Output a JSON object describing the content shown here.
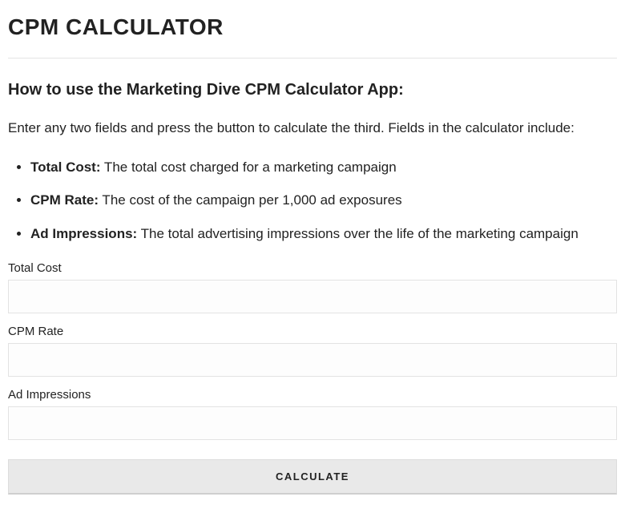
{
  "page_title": "CPM CALCULATOR",
  "section_heading": "How to use the Marketing Dive CPM Calculator App:",
  "intro_text": "Enter any two fields and press the button to calculate the third.  Fields in the calculator include:",
  "definitions": [
    {
      "term": "Total Cost:",
      "desc": " The total cost charged for a marketing campaign"
    },
    {
      "term": "CPM Rate:",
      "desc": " The cost of the campaign per 1,000 ad exposures"
    },
    {
      "term": "Ad Impressions:",
      "desc": " The total advertising impressions over the life of the marketing campaign"
    }
  ],
  "fields": {
    "total_cost": {
      "label": "Total Cost",
      "value": ""
    },
    "cpm_rate": {
      "label": "CPM Rate",
      "value": ""
    },
    "ad_impressions": {
      "label": "Ad Impressions",
      "value": ""
    }
  },
  "button_label": "CALCULATE"
}
